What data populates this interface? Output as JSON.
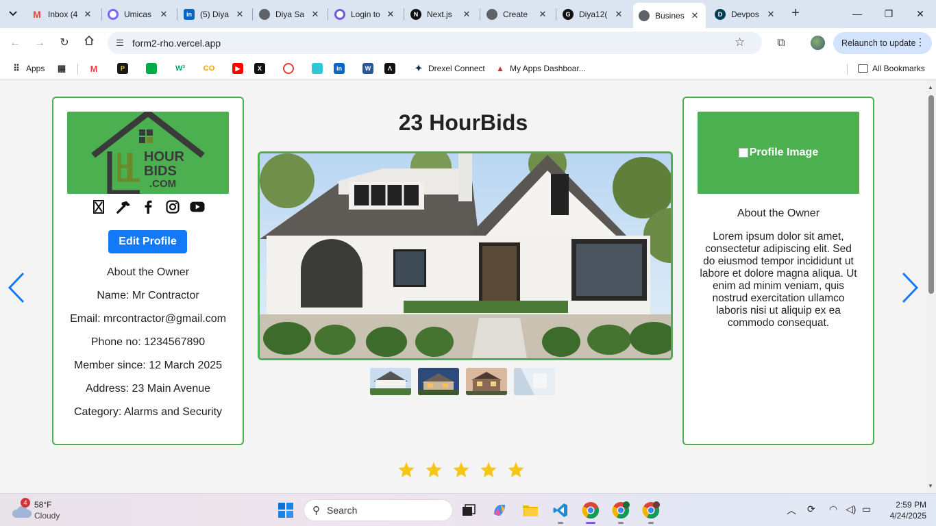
{
  "browser": {
    "tabs": [
      {
        "title": "Inbox (4",
        "icon": "gmail-icon",
        "color": "#ea4335",
        "letter": "M"
      },
      {
        "title": "Umicas",
        "icon": "umicas-icon",
        "color": "#7b61ff",
        "letter": "U"
      },
      {
        "title": "(5) Diya",
        "icon": "linkedin-icon",
        "color": "#0a66c2",
        "letter": "in"
      },
      {
        "title": "Diya Sa",
        "icon": "globe-icon",
        "color": "#5f6368",
        "letter": ""
      },
      {
        "title": "Login to",
        "icon": "login-icon",
        "color": "#7b61ff",
        "letter": "L"
      },
      {
        "title": "Next.js",
        "icon": "nextjs-icon",
        "color": "#111111",
        "letter": "N"
      },
      {
        "title": "Create",
        "icon": "globe-icon",
        "color": "#5f6368",
        "letter": ""
      },
      {
        "title": "Diya12(",
        "icon": "github-icon",
        "color": "#111111",
        "letter": "G"
      },
      {
        "title": "Busines",
        "icon": "globe-icon",
        "color": "#5f6368",
        "letter": "",
        "active": true
      },
      {
        "title": "Devpos",
        "icon": "devpost-icon",
        "color": "#003e54",
        "letter": "D"
      }
    ],
    "url": "form2-rho.vercel.app",
    "relaunch_label": "Relaunch to update",
    "bookmarks": {
      "apps_label": "Apps",
      "drexel_label": "Drexel Connect",
      "myapps_label": "My Apps Dashboar...",
      "all_label": "All Bookmarks"
    }
  },
  "page": {
    "title": "23 HourBids",
    "logo": {
      "line1": "HOUR",
      "line2": "BIDS",
      "line3": ".COM"
    },
    "edit_button": "Edit Profile",
    "owner": {
      "about": "About the Owner",
      "name": "Name: Mr Contractor",
      "email": "Email: mrcontractor@gmail.com",
      "phone": "Phone no: 1234567890",
      "member_since": "Member since: 12 March 2025",
      "address": "Address: 23 Main Avenue",
      "category": "Category: Alarms and Security"
    },
    "profile_image_alt": "Profile Image",
    "right_about": "About the Owner",
    "lorem": "Lorem ipsum dolor sit amet, consectetur adipiscing elit. Sed do eiusmod tempor incididunt ut labore et dolore magna aliqua. Ut enim ad minim veniam, quis nostrud exercitation ullamco laboris nisi ut aliquip ex ea commodo consequat.",
    "rating": 5,
    "rating_max": 5,
    "accent": "#4caf50",
    "button_color": "#1479f6",
    "star_color": "#f5c518"
  },
  "taskbar": {
    "weather_temp": "58°F",
    "weather_cond": "Cloudy",
    "weather_badge": "4",
    "search_placeholder": "Search",
    "time": "2:59 PM",
    "date": "4/24/2025"
  }
}
